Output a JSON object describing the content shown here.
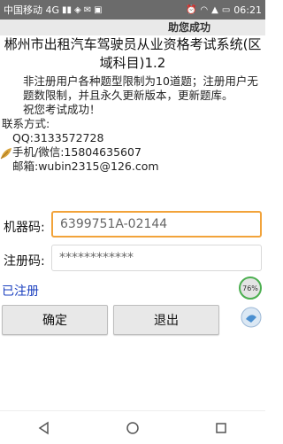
{
  "status_bar": {
    "carrier": "中国移动 4G",
    "time": "06:21"
  },
  "window": {
    "title": "助您成功"
  },
  "app": {
    "title": "郴州市出租汽车驾驶员从业资格考试系统(区域科目)1.2"
  },
  "info": {
    "notice": "非注册用户各种题型限制为10道题；注册用户无题数限制，并且永久更新版本，更新题库。",
    "wish": "祝您考试成功！",
    "contact_heading": "联系方式:",
    "qq": "QQ:3133572728",
    "phone": "手机/微信:15804635607",
    "email": "邮箱:wubin2315@126.com"
  },
  "form": {
    "machine_code_label": "机器码:",
    "machine_code_value": "6399751A-02144",
    "reg_code_label": "注册码:",
    "reg_code_value": "************"
  },
  "registration_status": "已注册",
  "progress_badge": "76%",
  "buttons": {
    "confirm": "确定",
    "exit": "退出"
  },
  "colors": {
    "accent_focus": "#f2a33a",
    "status_text": "#1a3fbf"
  }
}
